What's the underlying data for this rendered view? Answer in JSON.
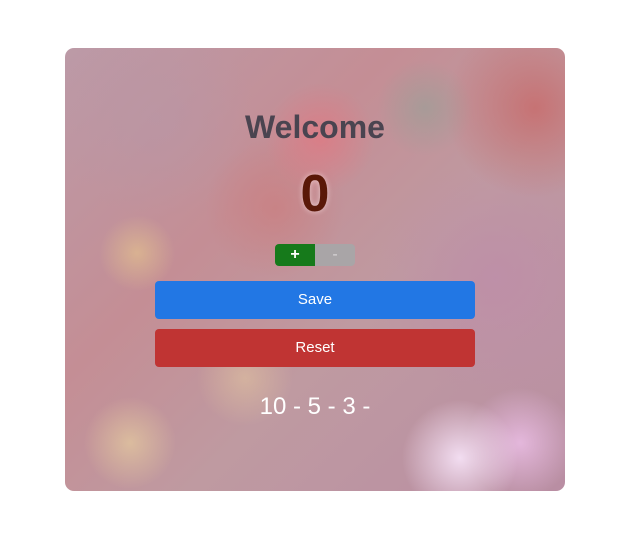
{
  "card": {
    "title": "Welcome",
    "counter_value": "0",
    "stepper": {
      "plus_label": "+",
      "minus_label": "-"
    },
    "save_label": "Save",
    "reset_label": "Reset",
    "history_text": "10 - 5 - 3 -"
  },
  "colors": {
    "plus_button": "#167a1b",
    "minus_button_disabled": "#a9a5a7",
    "save_button": "#2277e4",
    "reset_button": "#c03433",
    "counter_text": "#5a1808",
    "title_text": "#4a4450"
  }
}
